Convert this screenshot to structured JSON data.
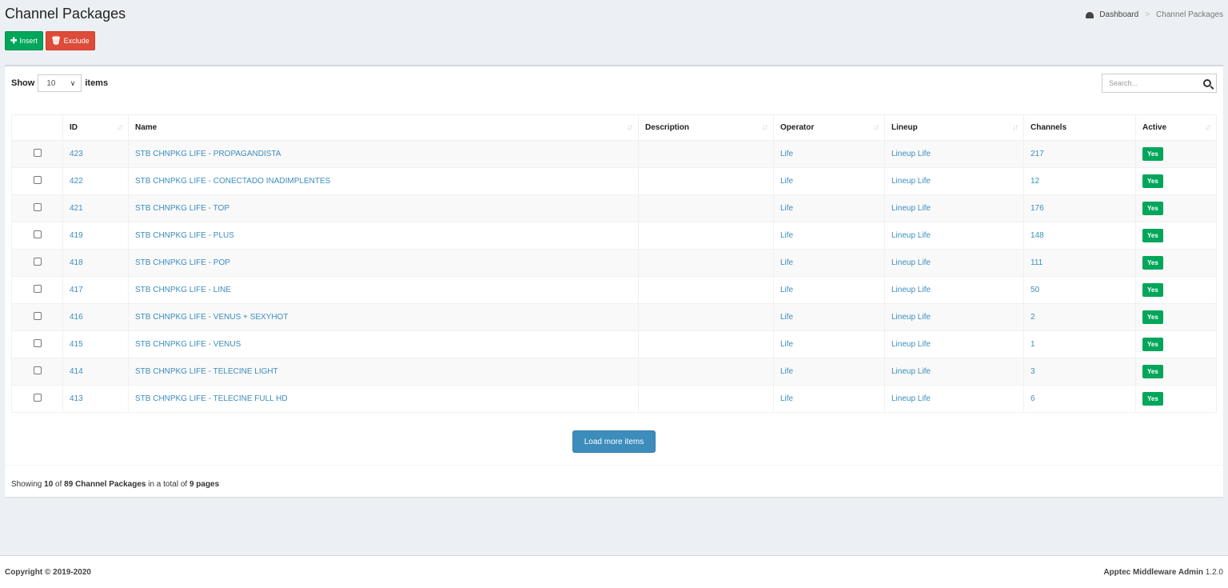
{
  "page": {
    "title": "Channel Packages"
  },
  "breadcrumb": {
    "home": "Dashboard",
    "current": "Channel Packages"
  },
  "actions": {
    "insert": "Insert",
    "exclude": "Exclude"
  },
  "toolbar": {
    "show_label": "Show",
    "page_size": "10",
    "items_label": "items",
    "search_placeholder": "Search..."
  },
  "table": {
    "headers": {
      "id": "ID",
      "name": "Name",
      "description": "Description",
      "operator": "Operator",
      "lineup": "Lineup",
      "channels": "Channels",
      "active": "Active"
    },
    "rows": [
      {
        "id": "423",
        "name": "STB CHNPKG LIFE - PROPAGANDISTA",
        "description": "",
        "operator": "Life",
        "lineup": "Lineup Life",
        "channels": "217",
        "active": "Yes"
      },
      {
        "id": "422",
        "name": "STB CHNPKG LIFE - CONECTADO INADIMPLENTES",
        "description": "",
        "operator": "Life",
        "lineup": "Lineup Life",
        "channels": "12",
        "active": "Yes"
      },
      {
        "id": "421",
        "name": "STB CHNPKG LIFE - TOP",
        "description": "",
        "operator": "Life",
        "lineup": "Lineup Life",
        "channels": "176",
        "active": "Yes"
      },
      {
        "id": "419",
        "name": "STB CHNPKG LIFE - PLUS",
        "description": "",
        "operator": "Life",
        "lineup": "Lineup Life",
        "channels": "148",
        "active": "Yes"
      },
      {
        "id": "418",
        "name": "STB CHNPKG LIFE - POP",
        "description": "",
        "operator": "Life",
        "lineup": "Lineup Life",
        "channels": "111",
        "active": "Yes"
      },
      {
        "id": "417",
        "name": "STB CHNPKG LIFE - LINE",
        "description": "",
        "operator": "Life",
        "lineup": "Lineup Life",
        "channels": "50",
        "active": "Yes"
      },
      {
        "id": "416",
        "name": "STB CHNPKG LIFE - VENUS + SEXYHOT",
        "description": "",
        "operator": "Life",
        "lineup": "Lineup Life",
        "channels": "2",
        "active": "Yes"
      },
      {
        "id": "415",
        "name": "STB CHNPKG LIFE - VENUS",
        "description": "",
        "operator": "Life",
        "lineup": "Lineup Life",
        "channels": "1",
        "active": "Yes"
      },
      {
        "id": "414",
        "name": "STB CHNPKG LIFE - TELECINE LIGHT",
        "description": "",
        "operator": "Life",
        "lineup": "Lineup Life",
        "channels": "3",
        "active": "Yes"
      },
      {
        "id": "413",
        "name": "STB CHNPKG LIFE - TELECINE FULL HD",
        "description": "",
        "operator": "Life",
        "lineup": "Lineup Life",
        "channels": "6",
        "active": "Yes"
      }
    ]
  },
  "load_more": "Load more items",
  "summary": {
    "prefix": "Showing",
    "shown": "10",
    "of": "of",
    "total": "89 Channel Packages",
    "mid": "in a total of",
    "pages": "9 pages"
  },
  "footer": {
    "copyright": "Copyright © 2019-2020",
    "app_name": "Apptec Middleware Admin",
    "version": "1.2.0"
  },
  "colors": {
    "success": "#00a65a",
    "danger": "#dd4b39",
    "primary": "#3c8dbc",
    "background": "#ecf0f5"
  },
  "icons": {
    "insert": "plus-icon",
    "exclude": "trash-icon",
    "dashboard": "dashboard-icon",
    "search": "search-icon",
    "sort": "sort-icon"
  }
}
